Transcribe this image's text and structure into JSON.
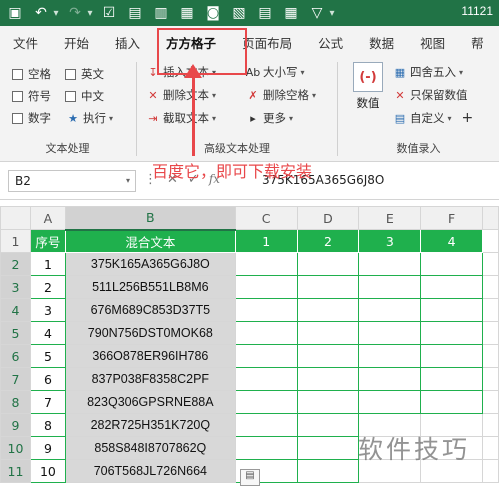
{
  "titlebar": {
    "title": "11121",
    "quick_access": [
      "save-icon",
      "undo-icon",
      "redo-icon",
      "checkbox-icon",
      "table-icon",
      "chart-icon",
      "grid-icon",
      "camera-icon",
      "image-icon",
      "table2-icon",
      "grid2-icon",
      "filter-icon"
    ]
  },
  "tabs": [
    "文件",
    "开始",
    "插入",
    "方方格子",
    "页面布局",
    "公式",
    "数据",
    "视图",
    "帮"
  ],
  "ribbon": {
    "text_processing": {
      "checkboxes": [
        "空格",
        "英文",
        "符号",
        "中文",
        "数字",
        "执行"
      ],
      "group_label": "文本处理"
    },
    "advanced_text": {
      "buttons": [
        "插入文本",
        "删除文本",
        "截取文本",
        "大小写",
        "删除空格",
        "更多"
      ],
      "group_label": "高级文本处理"
    },
    "numeric_entry": {
      "big_button": "数值",
      "buttons": [
        "四舍五入",
        "只保留数值",
        "自定义"
      ],
      "group_label": "数值录入"
    },
    "annotation": "百度它，即可下载安装"
  },
  "formula_bar": {
    "name_box": "B2",
    "formula": "375K165A365G6J8O"
  },
  "sheet": {
    "columns": [
      "A",
      "B",
      "C",
      "D",
      "E",
      "F"
    ],
    "header_row": [
      "序号",
      "混合文本",
      "1",
      "2",
      "3",
      "4"
    ],
    "rows": [
      {
        "num": "1",
        "text": "375K165A365G6J8O"
      },
      {
        "num": "2",
        "text": "511L256B551LB8M6"
      },
      {
        "num": "3",
        "text": "676M689C853D37T5"
      },
      {
        "num": "4",
        "text": "790N756DST0MOK68"
      },
      {
        "num": "5",
        "text": "366O878ER96IH786"
      },
      {
        "num": "6",
        "text": "837P038F8358C2PF"
      },
      {
        "num": "7",
        "text": "823Q306GPSRNE88A"
      },
      {
        "num": "8",
        "text": "282R725H351K720Q"
      },
      {
        "num": "9",
        "text": "858S848I8707862Q"
      },
      {
        "num": "10",
        "text": "706T568JL726N664"
      }
    ],
    "row_numbers": [
      "1",
      "2",
      "3",
      "4",
      "5",
      "6",
      "7",
      "8",
      "9",
      "10",
      "11"
    ]
  },
  "watermark": "软件技巧",
  "colors": {
    "excel_green": "#217346",
    "table_header_green": "#1fb04d",
    "highlight_red": "#e8474a",
    "selection_gray": "#d8d8d8"
  }
}
